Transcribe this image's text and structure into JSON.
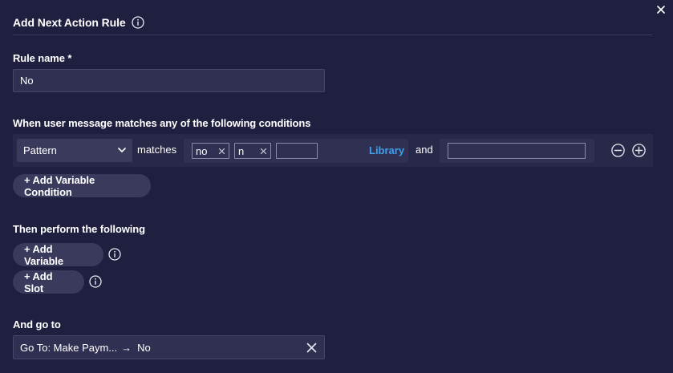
{
  "dialog": {
    "title": "Add Next Action Rule"
  },
  "rule_name": {
    "label": "Rule name *",
    "value": "No"
  },
  "conditions": {
    "label": "When user message matches any of the following conditions",
    "match_type": "Pattern",
    "matches_text": "matches",
    "tags": [
      "no",
      "n"
    ],
    "library_label": "Library",
    "and_text": "and",
    "and_value": "",
    "add_variable_condition_label": "+ Add Variable Condition"
  },
  "actions": {
    "label": "Then perform the following",
    "add_variable_label": "+ Add Variable",
    "add_slot_label": "+ Add Slot"
  },
  "goto": {
    "label": "And go to",
    "target": "Go To: Make Paym...",
    "arrow": "→",
    "value": "No"
  },
  "colors": {
    "background": "#1f2040",
    "input_bg": "#2f3052",
    "button_bg": "#3a3b5c",
    "link": "#3aa0f0"
  }
}
